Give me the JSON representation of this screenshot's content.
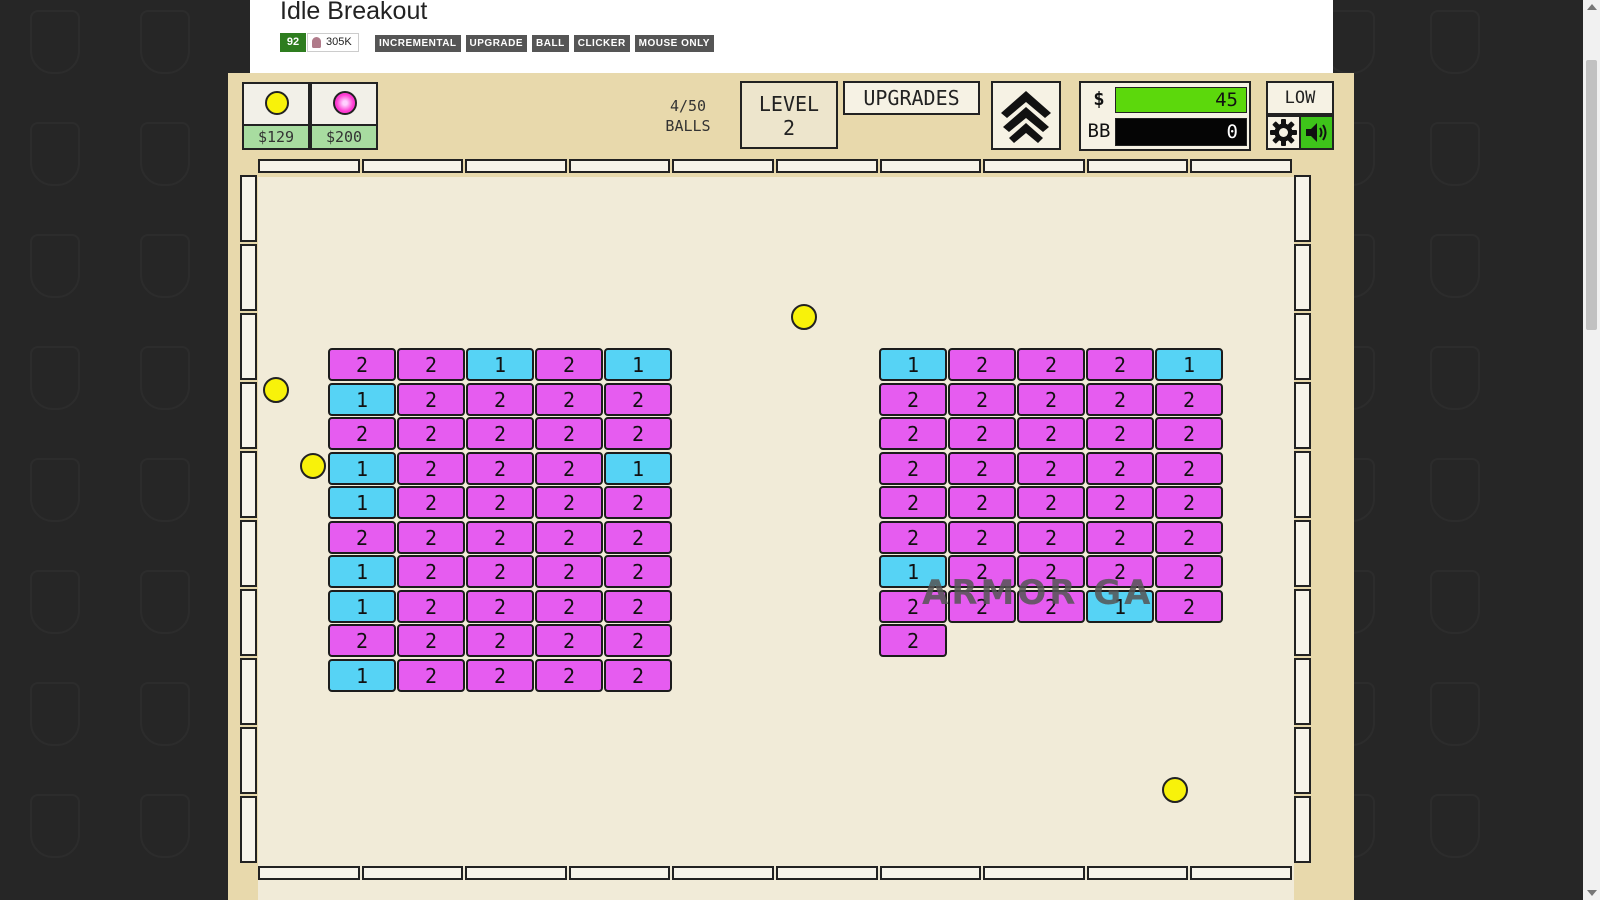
{
  "page": {
    "title": "Idle Breakout",
    "rating": "92",
    "plays": "305K",
    "tags": [
      "INCREMENTAL",
      "UPGRADE",
      "BALL",
      "CLICKER",
      "MOUSE ONLY"
    ]
  },
  "hud": {
    "shop": [
      {
        "price": "$129",
        "ball_color": "#f8f20a",
        "icon": "basic-ball-icon"
      },
      {
        "price": "$200",
        "ball_color": "#ff3ad2",
        "icon": "plasma-ball-icon"
      }
    ],
    "balls_line1": "4/50",
    "balls_line2": "BALLS",
    "level_line1": "LEVEL",
    "level_line2": "2",
    "upgrades_label": "UPGRADES",
    "money_label": "$",
    "money_value": "45",
    "money_fill_fraction": 1.0,
    "bb_label": "BB",
    "bb_value": "0",
    "quality_label": "LOW",
    "colors": {
      "money_bar": "#5cd80c",
      "sound_on": "#3ec41a",
      "brick_hp2": "#e65cf0",
      "brick_hp1": "#56d3f5",
      "ball": "#f8f20a"
    }
  },
  "board": {
    "left_grid": [
      [
        "2",
        "2",
        "1",
        "2",
        "1"
      ],
      [
        "1",
        "2",
        "2",
        "2",
        "2"
      ],
      [
        "2",
        "2",
        "2",
        "2",
        "2"
      ],
      [
        "1",
        "2",
        "2",
        "2",
        "1"
      ],
      [
        "1",
        "2",
        "2",
        "2",
        "2"
      ],
      [
        "2",
        "2",
        "2",
        "2",
        "2"
      ],
      [
        "1",
        "2",
        "2",
        "2",
        "2"
      ],
      [
        "1",
        "2",
        "2",
        "2",
        "2"
      ],
      [
        "2",
        "2",
        "2",
        "2",
        "2"
      ],
      [
        "1",
        "2",
        "2",
        "2",
        "2"
      ]
    ],
    "right_grid": [
      [
        "1",
        "2",
        "2",
        "2",
        "1"
      ],
      [
        "2",
        "2",
        "2",
        "2",
        "2"
      ],
      [
        "2",
        "2",
        "2",
        "2",
        "2"
      ],
      [
        "2",
        "2",
        "2",
        "2",
        "2"
      ],
      [
        "2",
        "2",
        "2",
        "2",
        "2"
      ],
      [
        "2",
        "2",
        "2",
        "2",
        "2"
      ],
      [
        "1",
        "2",
        "2",
        "2",
        "2"
      ],
      [
        "2",
        "2",
        "2",
        "1",
        "2"
      ],
      [
        "2"
      ]
    ],
    "watermark": "ARMOR GA"
  }
}
